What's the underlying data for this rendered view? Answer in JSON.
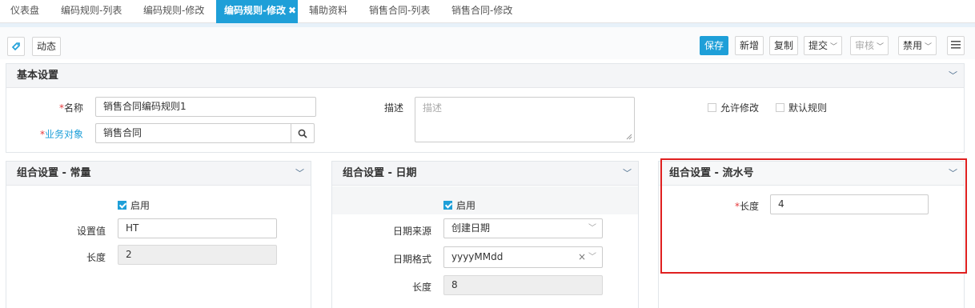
{
  "tabs": [
    {
      "label": "仪表盘",
      "active": false
    },
    {
      "label": "编码规则-列表",
      "active": false
    },
    {
      "label": "编码规则-修改",
      "active": false
    },
    {
      "label": "编码规则-修改",
      "active": true
    },
    {
      "label": "辅助资料",
      "active": false
    },
    {
      "label": "销售合同-列表",
      "active": false
    },
    {
      "label": "销售合同-修改",
      "active": false
    }
  ],
  "toolbar": {
    "dynamic": "动态",
    "save": "保存",
    "new": "新增",
    "copy": "复制",
    "submit": "提交",
    "review": "审核",
    "disable": "禁用"
  },
  "basic": {
    "title": "基本设置",
    "name_label": "名称",
    "name_value": "销售合同编码规则1",
    "object_label": "业务对象",
    "object_value": "销售合同",
    "desc_label": "描述",
    "desc_placeholder": "描述",
    "allow_edit": "允许修改",
    "default_rule": "默认规则"
  },
  "constant": {
    "title": "组合设置 - 常量",
    "enable": "启用",
    "value_label": "设置值",
    "value": "HT",
    "length_label": "长度",
    "length": "2"
  },
  "date": {
    "title": "组合设置 - 日期",
    "enable": "启用",
    "source_label": "日期来源",
    "source": "创建日期",
    "format_label": "日期格式",
    "format": "yyyyMMdd",
    "length_label": "长度",
    "length": "8"
  },
  "serial": {
    "title": "组合设置 - 流水号",
    "length_label": "长度",
    "length": "4"
  },
  "colors": {
    "accent": "#1e9fd8",
    "required": "#e4393c",
    "highlight": "#e02020"
  }
}
